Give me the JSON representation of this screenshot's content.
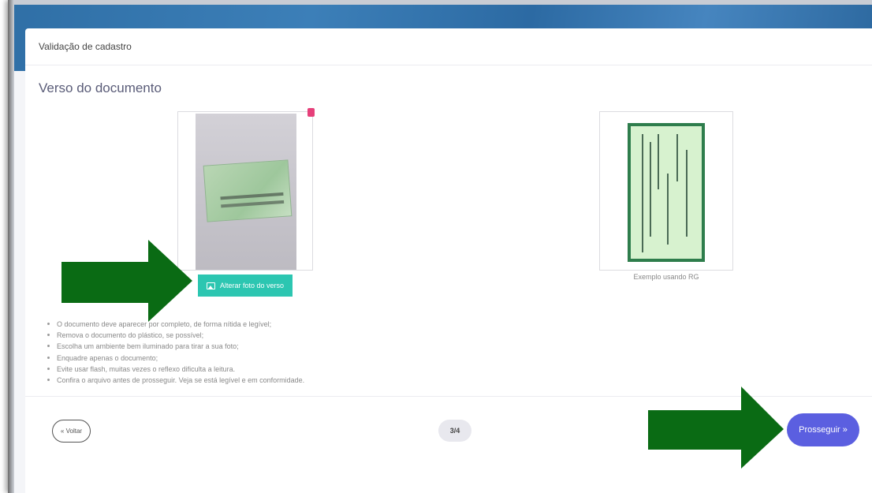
{
  "card": {
    "header_title": "Validação de cadastro",
    "section_title": "Verso do documento"
  },
  "upload": {
    "change_photo_label": "Alterar foto do verso"
  },
  "example": {
    "caption": "Exemplo usando RG"
  },
  "tips": [
    "O documento deve aparecer por completo, de forma nítida e legível;",
    "Remova o documento do plástico, se possível;",
    "Escolha um ambiente bem iluminado para tirar a sua foto;",
    "Enquadre apenas o documento;",
    "Evite usar flash, muitas vezes o reflexo dificulta a leitura.",
    "Confira o arquivo antes de prosseguir. Veja se está legível e em conformidade."
  ],
  "footer": {
    "back_label": "« Voltar",
    "step": "3/4",
    "next_label": "Prosseguir »"
  },
  "icons": {
    "delete": "trash-icon",
    "change_photo": "image-icon"
  },
  "colors": {
    "accent_teal": "#2cc6b1",
    "primary_button": "#5b5fe0",
    "annotation_arrow": "#0a6b14",
    "delete_icon": "#e6407a"
  }
}
